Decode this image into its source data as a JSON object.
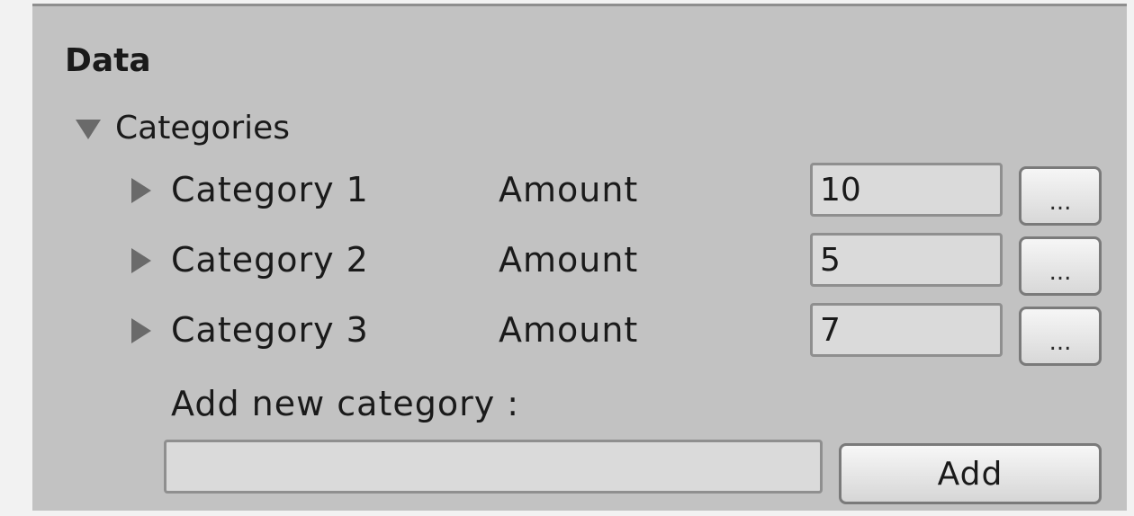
{
  "panel": {
    "title": "Data"
  },
  "categories": {
    "label": "Categories",
    "items": [
      {
        "label": "Category 1",
        "amount_label": "Amount",
        "amount_value": "10",
        "more_label": "..."
      },
      {
        "label": "Category 2",
        "amount_label": "Amount",
        "amount_value": "5",
        "more_label": "..."
      },
      {
        "label": "Category 3",
        "amount_label": "Amount",
        "amount_value": "7",
        "more_label": "..."
      }
    ]
  },
  "add_new": {
    "label": "Add new category :",
    "input_value": "",
    "button_label": "Add"
  }
}
